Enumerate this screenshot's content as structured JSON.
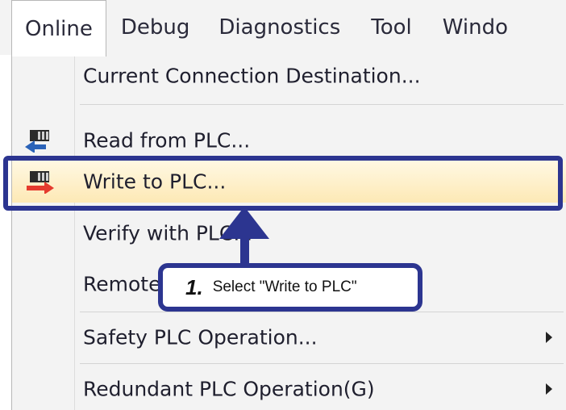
{
  "menubar": {
    "items": [
      {
        "label": "Online",
        "active": true
      },
      {
        "label": "Debug"
      },
      {
        "label": "Diagnostics"
      },
      {
        "label": "Tool"
      },
      {
        "label": "Windo"
      }
    ]
  },
  "online_menu": {
    "items": [
      {
        "label": "Current Connection Destination...",
        "icon": "none"
      },
      {
        "label": "Read from PLC...",
        "icon": "read-from-plc-icon"
      },
      {
        "label": "Write to PLC...",
        "icon": "write-to-plc-icon",
        "highlighted": true
      },
      {
        "label": "Verify with PLC...",
        "icon": "none"
      },
      {
        "label": "Remote Operation...",
        "icon": "none"
      },
      {
        "label": "Safety PLC Operation...",
        "icon": "none",
        "submenu": true
      },
      {
        "label": "Redundant PLC Operation(G)",
        "icon": "none",
        "submenu": true
      }
    ]
  },
  "callout": {
    "step": "1.",
    "text": "Select \"Write to PLC\""
  },
  "colors": {
    "accent": "#2c3590",
    "highlight": "#fde9b5",
    "menubar_bg": "#f3f3f3"
  }
}
